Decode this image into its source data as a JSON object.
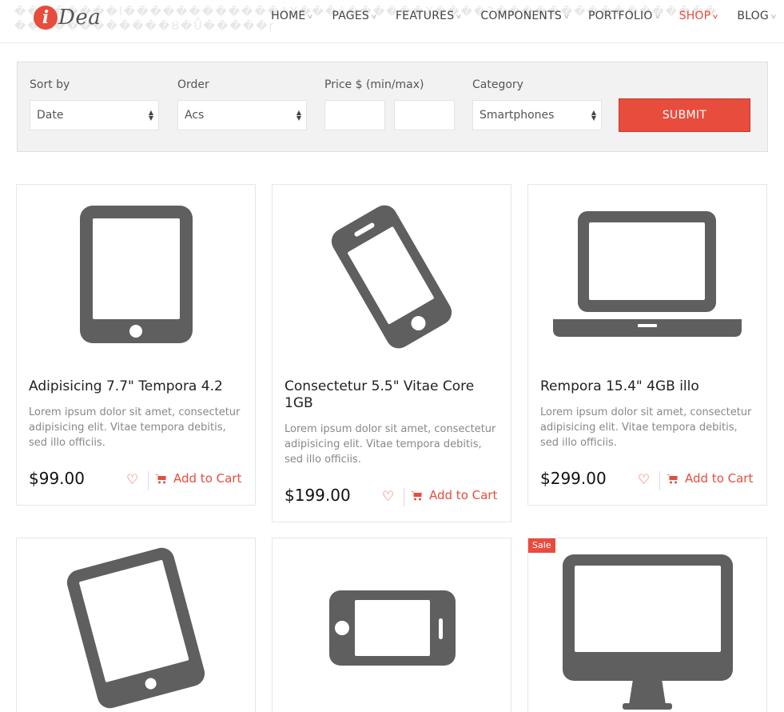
{
  "header": {
    "logo_initial": "i",
    "logo_text": "Dea",
    "garbled_text": "��������l������������AX���ǹ������X����3����������������� ������������Ȣ�Ǖ�����ŗ",
    "nav": [
      {
        "label": "HOME",
        "active": false
      },
      {
        "label": "PAGES",
        "active": false
      },
      {
        "label": "FEATURES",
        "active": false
      },
      {
        "label": "COMPONENTS",
        "active": false
      },
      {
        "label": "PORTFOLIO",
        "active": false
      },
      {
        "label": "SHOP",
        "active": true
      },
      {
        "label": "BLOG",
        "active": false
      }
    ]
  },
  "filter": {
    "sort_label": "Sort by",
    "sort_value": "Date",
    "order_label": "Order",
    "order_value": "Acs",
    "price_label": "Price $ (min/max)",
    "price_min": "",
    "price_max": "",
    "category_label": "Category",
    "category_value": "Smartphones",
    "submit_label": "SUBMIT"
  },
  "products": [
    {
      "name": "Adipisicing 7.7\" Tempora 4.2",
      "desc": "Lorem ipsum dolor sit amet, consectetur adipisicing elit. Vitae tempora debitis, sed illo officiis.",
      "price": "$99.00",
      "cart_label": "Add to Cart",
      "icon": "tablet-icon"
    },
    {
      "name": "Consectetur 5.5\" Vitae Core 1GB",
      "desc": "Lorem ipsum dolor sit amet, consectetur adipisicing elit. Vitae tempora debitis, sed illo officiis.",
      "price": "$199.00",
      "cart_label": "Add to Cart",
      "icon": "smartphone-icon"
    },
    {
      "name": "Rempora 15.4\" 4GB illo",
      "desc": "Lorem ipsum dolor sit amet, consectetur adipisicing elit. Vitae tempora debitis, sed illo officiis.",
      "price": "$299.00",
      "cart_label": "Add to Cart",
      "icon": "laptop-icon"
    },
    {
      "icon": "tablet-icon"
    },
    {
      "icon": "smartphone-landscape-icon"
    },
    {
      "icon": "desktop-monitor-icon",
      "badge": "Sale"
    }
  ],
  "colors": {
    "accent": "#e84c3d",
    "icon_gray": "#5f5f5f"
  }
}
